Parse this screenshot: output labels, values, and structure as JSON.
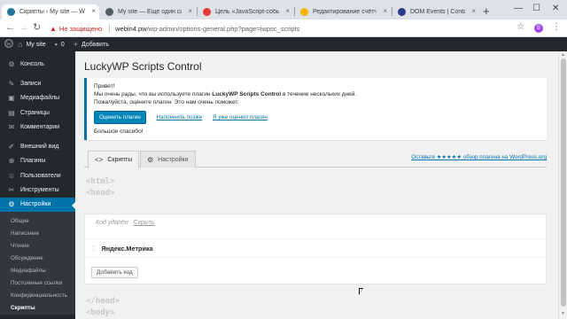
{
  "browser": {
    "tabs": [
      {
        "label": "Скрипты ‹ My site — WordPr",
        "icon_color": "#21759b",
        "active": true
      },
      {
        "label": "My site — Еще один сайт н",
        "icon_color": "#555d66",
        "active": false
      },
      {
        "label": "Цель «JavaScript-событие»",
        "icon_color": "#e53935",
        "active": false
      },
      {
        "label": "Редактирование счётчика",
        "icon_color": "#f4b400",
        "active": false
      },
      {
        "label": "DOM Events | Contact Form",
        "icon_color": "#2a3b8f",
        "active": false
      }
    ],
    "new_tab": "+",
    "close_glyph": "×",
    "window_controls": {
      "minimize": "—",
      "maximize": "☐",
      "close": "✕"
    },
    "omnibox": {
      "warning_icon": "▲",
      "insecure_label": "Не защищено",
      "host": "webin4.pw",
      "path": "/wp-admin/options-general.php?page=lwpsc_scripts"
    },
    "nav": {
      "back": "←",
      "forward": "→",
      "reload": "↻"
    },
    "star": "☆",
    "profile_initial": "B",
    "menu": "⋮"
  },
  "adminbar": {
    "site_name": "My site",
    "comments_count": "0",
    "add_label": "Добавить"
  },
  "sidebar": {
    "items": [
      {
        "label": "Консоль",
        "icon": "⚙"
      },
      {
        "label": "Записи",
        "icon": "✎"
      },
      {
        "label": "Медиафайлы",
        "icon": "▣"
      },
      {
        "label": "Страницы",
        "icon": "▤"
      },
      {
        "label": "Комментарии",
        "icon": "✉"
      },
      {
        "label": "Внешний вид",
        "icon": "✐"
      },
      {
        "label": "Плагины",
        "icon": "⊕"
      },
      {
        "label": "Пользователи",
        "icon": "☺"
      },
      {
        "label": "Инструменты",
        "icon": "✂"
      },
      {
        "label": "Настройки",
        "icon": "⚙",
        "current": true
      }
    ],
    "submenu": [
      "Общие",
      "Написание",
      "Чтение",
      "Обсуждение",
      "Медиафайлы",
      "Постоянные ссылки",
      "Конфиденциальность",
      "Скрипты"
    ]
  },
  "main": {
    "title": "LuckyWP Scripts Control",
    "notice": {
      "greeting": "Привет!",
      "line1_prefix": "Мы очень рады, что вы используете плагин ",
      "plugin_name": "LuckyWP Scripts Control",
      "line1_suffix": " в течение нескольких дней.",
      "line2": "Пожалуйста, оцените плагин. Это нам очень поможет.",
      "rate_button": "Оценить плагин",
      "remind_link": "Напомнить позже",
      "already_link": "Я уже оценил плагин",
      "thanks": "Большое спасибо!"
    },
    "tabs": [
      {
        "label": "Скрипты",
        "icon": "<>",
        "active": true
      },
      {
        "label": "Настройки",
        "icon": "⚙",
        "active": false
      }
    ],
    "review_link": "Оставьте ★★★★★ обзор плагина на WordPress.org",
    "code_tags": {
      "html_open": "<html>",
      "head_open": "<head>",
      "head_close": "</head>",
      "body_open": "<body>"
    },
    "panel": {
      "deleted_text": "Код удалён",
      "restore_link": "Скрыть",
      "item_name": "Яндекс.Метрика",
      "add_button": "Добавить код",
      "drag_icon": "⁞⁞"
    }
  }
}
